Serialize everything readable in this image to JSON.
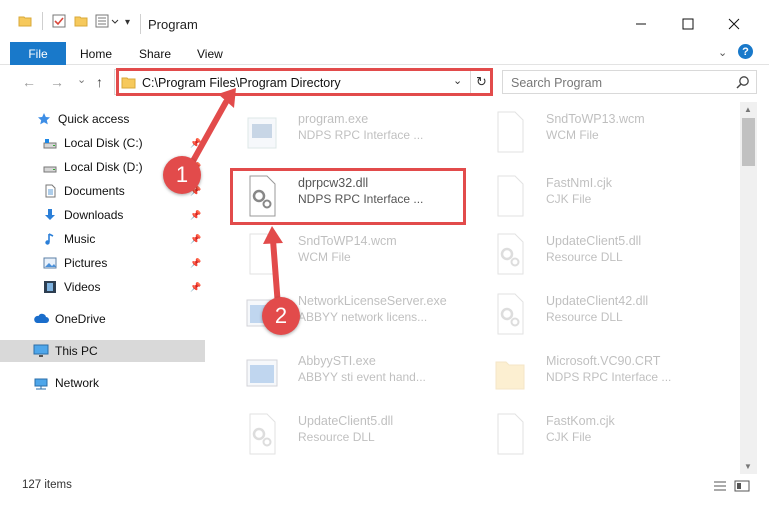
{
  "window": {
    "title": "Program",
    "minimize_label": "—",
    "maximize_label": "☐",
    "close_label": "✕"
  },
  "ribbon": {
    "file_tab": "File",
    "tabs": [
      "Home",
      "Share",
      "View"
    ],
    "help_label": "?"
  },
  "nav": {
    "back": "←",
    "forward": "→",
    "recent": "⌄",
    "up": "↑"
  },
  "address": {
    "path": "C:\\Program Files\\Program Directory",
    "dropdown": "⌄",
    "refresh": "↻"
  },
  "search": {
    "placeholder": "Search Program"
  },
  "sidebar": {
    "items": [
      {
        "label": "Quick access",
        "icon": "star-icon",
        "pinned": false
      },
      {
        "label": "Local Disk (C:)",
        "icon": "drive-icon",
        "pinned": true
      },
      {
        "label": "Local Disk (D:)",
        "icon": "drive-icon",
        "pinned": true
      },
      {
        "label": "Documents",
        "icon": "documents-icon",
        "pinned": true
      },
      {
        "label": "Downloads",
        "icon": "download-icon",
        "pinned": true
      },
      {
        "label": "Music",
        "icon": "music-icon",
        "pinned": true
      },
      {
        "label": "Pictures",
        "icon": "pictures-icon",
        "pinned": true
      },
      {
        "label": "Videos",
        "icon": "videos-icon",
        "pinned": true
      },
      {
        "label": "OneDrive",
        "icon": "cloud-icon",
        "pinned": false
      },
      {
        "label": "This PC",
        "icon": "computer-icon",
        "pinned": false,
        "selected": true
      },
      {
        "label": "Network",
        "icon": "network-icon",
        "pinned": false
      }
    ]
  },
  "files": [
    {
      "name": "program.exe",
      "type": "NDPS RPC Interface ...",
      "icon": "exe-icon",
      "faded": true
    },
    {
      "name": "SndToWP13.wcm",
      "type": "WCM File",
      "icon": "blank-file-icon",
      "faded": true
    },
    {
      "name": "dprpcw32.dll",
      "type": "NDPS RPC Interface ...",
      "icon": "dll-gear-icon",
      "faded": false
    },
    {
      "name": "FastNmI.cjk",
      "type": "CJK File",
      "icon": "blank-file-icon",
      "faded": true
    },
    {
      "name": "SndToWP14.wcm",
      "type": "WCM File",
      "icon": "blank-file-icon",
      "faded": true
    },
    {
      "name": "UpdateClient5.dll",
      "type": "Resource DLL",
      "icon": "dll-gear-icon",
      "faded": true
    },
    {
      "name": "NetworkLicenseServer.exe",
      "type": "ABBYY network licens...",
      "icon": "exe-window-icon",
      "faded": true
    },
    {
      "name": "UpdateClient42.dll",
      "type": "Resource DLL",
      "icon": "dll-gear-icon",
      "faded": true
    },
    {
      "name": "AbbyySTI.exe",
      "type": "ABBYY sti event hand...",
      "icon": "exe-window-icon",
      "faded": true
    },
    {
      "name": "Microsoft.VC90.CRT",
      "type": "NDPS RPC Interface ...",
      "icon": "folder-icon",
      "faded": true
    },
    {
      "name": "UpdateClient5.dll",
      "type": "Resource DLL",
      "icon": "dll-gear-icon",
      "faded": true
    },
    {
      "name": "FastKom.cjk",
      "type": "CJK File",
      "icon": "blank-file-icon",
      "faded": true
    }
  ],
  "status": {
    "item_count": "127 items"
  },
  "annotations": {
    "step1": "1",
    "step2": "2"
  },
  "colors": {
    "accent": "#1979ca",
    "highlight": "#e24b4b",
    "selected": "#d9d9d9"
  }
}
